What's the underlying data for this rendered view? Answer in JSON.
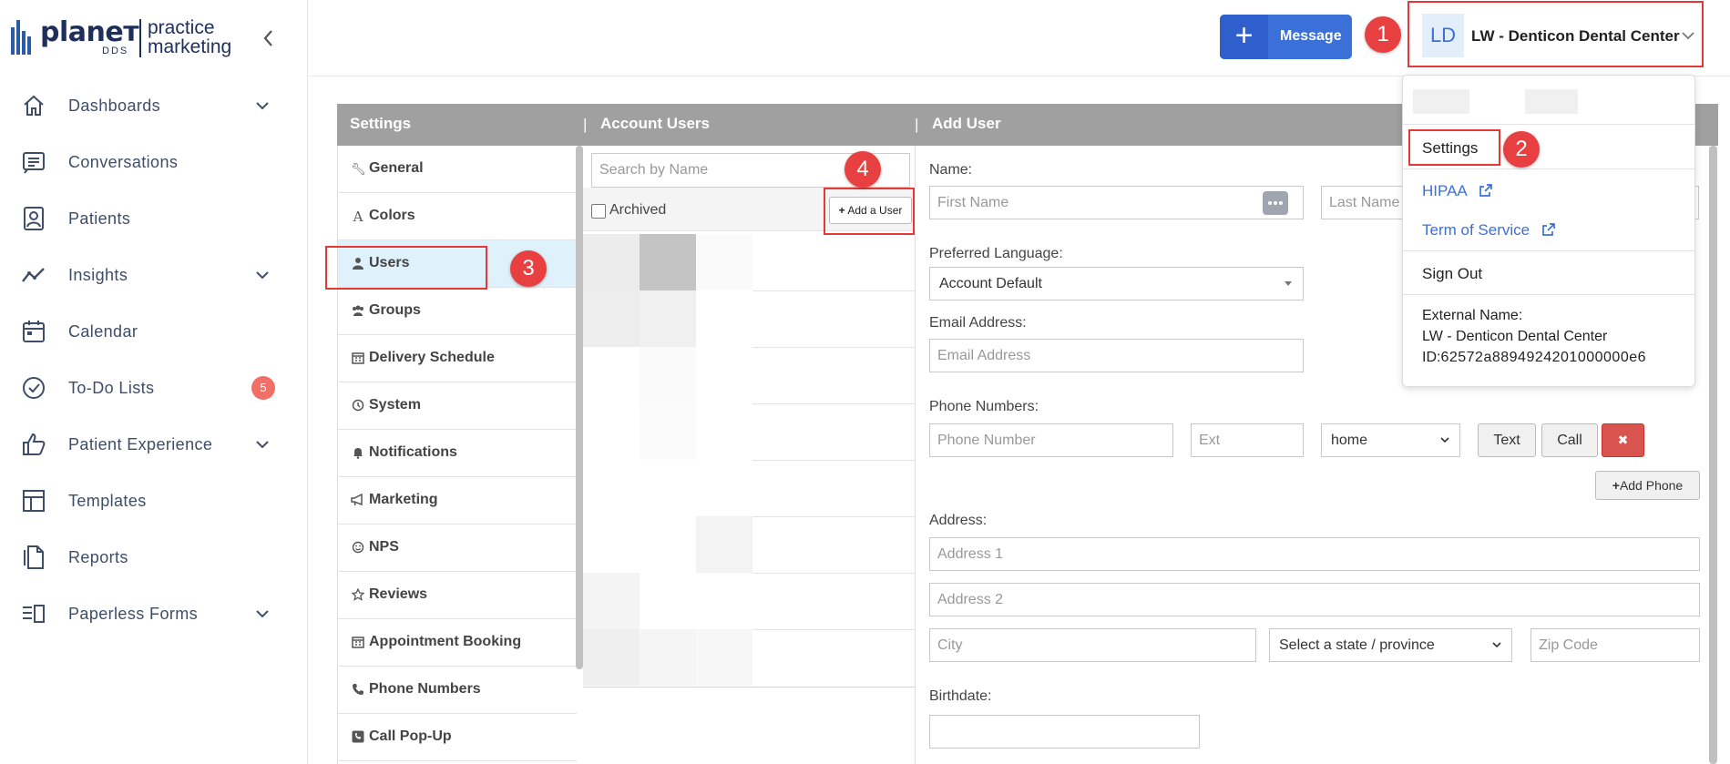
{
  "brand": {
    "logo_word": "planeт",
    "logo_sub": "DDS",
    "logo_product": [
      "practice",
      "marketing"
    ]
  },
  "nav": {
    "items": [
      {
        "label": "Dashboards",
        "icon": "home-icon",
        "has_chevron": true
      },
      {
        "label": "Conversations",
        "icon": "conversations-icon"
      },
      {
        "label": "Patients",
        "icon": "patients-icon"
      },
      {
        "label": "Insights",
        "icon": "insights-icon",
        "has_chevron": true
      },
      {
        "label": "Calendar",
        "icon": "calendar-icon"
      },
      {
        "label": "To-Do Lists",
        "icon": "checkmark-circle-icon",
        "badge": "5"
      },
      {
        "label": "Patient Experience",
        "icon": "thumbs-up-icon",
        "has_chevron": true
      },
      {
        "label": "Templates",
        "icon": "templates-icon"
      },
      {
        "label": "Reports",
        "icon": "reports-icon"
      },
      {
        "label": "Paperless Forms",
        "icon": "forms-icon",
        "has_chevron": true
      }
    ]
  },
  "topbar": {
    "message_label": "Message",
    "account_initials": "LD",
    "account_name": "LW - Denticon Dental Center"
  },
  "callouts": [
    "1",
    "2",
    "3",
    "4"
  ],
  "panel": {
    "settings_header": "Settings",
    "users_header": "Account Users",
    "form_header": "Add User",
    "separator": "|"
  },
  "settings_items": [
    {
      "label": "General",
      "icon": "wrench-icon"
    },
    {
      "label": "Colors",
      "icon": "font-icon"
    },
    {
      "label": "Users",
      "icon": "user-icon",
      "active": true
    },
    {
      "label": "Groups",
      "icon": "users-icon"
    },
    {
      "label": "Delivery Schedule",
      "icon": "calendar-icon"
    },
    {
      "label": "System",
      "icon": "clock-icon"
    },
    {
      "label": "Notifications",
      "icon": "bell-icon"
    },
    {
      "label": "Marketing",
      "icon": "bullhorn-icon"
    },
    {
      "label": "NPS",
      "icon": "smile-icon"
    },
    {
      "label": "Reviews",
      "icon": "star-icon"
    },
    {
      "label": "Appointment Booking",
      "icon": "calendar-icon"
    },
    {
      "label": "Phone Numbers",
      "icon": "phone-icon"
    },
    {
      "label": "Call Pop-Up",
      "icon": "phone-square-icon"
    }
  ],
  "users": {
    "search_placeholder": "Search by Name",
    "archived_label": "Archived",
    "add_user_label": "Add a User"
  },
  "form": {
    "name_label": "Name:",
    "first_name_placeholder": "First Name",
    "last_name_placeholder": "Last Name",
    "language_label": "Preferred Language:",
    "language_value": "Account Default",
    "email_label": "Email Address:",
    "email_placeholder": "Email Address",
    "phone_label": "Phone Numbers:",
    "phone_placeholder": "Phone Number",
    "ext_placeholder": "Ext",
    "phone_type": "home",
    "text_label": "Text",
    "call_label": "Call",
    "remove_label": "✖",
    "add_phone_label": "Add Phone",
    "address_label": "Address:",
    "address1_placeholder": "Address 1",
    "address2_placeholder": "Address 2",
    "city_placeholder": "City",
    "state_value": "Select a state / province",
    "zip_placeholder": "Zip Code",
    "birthdate_label": "Birthdate:"
  },
  "account_menu": {
    "settings_label": "Settings",
    "hipaa_label": "HIPAA",
    "tos_label": "Term of Service",
    "signout_label": "Sign Out",
    "external_name_label": "External Name:",
    "external_name_value": "LW - Denticon Dental Center",
    "id_label": "ID:",
    "id_value": "62572a8894924201000000e6"
  },
  "colors": {
    "accent": "#3c70d9",
    "callout": "#e84040",
    "header_gray": "#a0a0a0",
    "active_row": "#dff1fb",
    "danger": "#d9534f"
  }
}
